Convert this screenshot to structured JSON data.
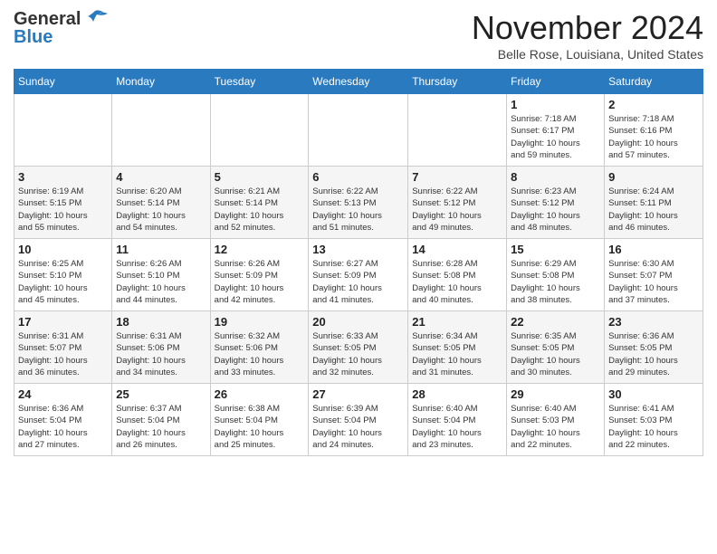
{
  "header": {
    "logo_line1": "General",
    "logo_line2": "Blue",
    "month_title": "November 2024",
    "location": "Belle Rose, Louisiana, United States"
  },
  "days_of_week": [
    "Sunday",
    "Monday",
    "Tuesday",
    "Wednesday",
    "Thursday",
    "Friday",
    "Saturday"
  ],
  "weeks": [
    [
      {
        "day": "",
        "info": ""
      },
      {
        "day": "",
        "info": ""
      },
      {
        "day": "",
        "info": ""
      },
      {
        "day": "",
        "info": ""
      },
      {
        "day": "",
        "info": ""
      },
      {
        "day": "1",
        "info": "Sunrise: 7:18 AM\nSunset: 6:17 PM\nDaylight: 10 hours\nand 59 minutes."
      },
      {
        "day": "2",
        "info": "Sunrise: 7:18 AM\nSunset: 6:16 PM\nDaylight: 10 hours\nand 57 minutes."
      }
    ],
    [
      {
        "day": "3",
        "info": "Sunrise: 6:19 AM\nSunset: 5:15 PM\nDaylight: 10 hours\nand 55 minutes."
      },
      {
        "day": "4",
        "info": "Sunrise: 6:20 AM\nSunset: 5:14 PM\nDaylight: 10 hours\nand 54 minutes."
      },
      {
        "day": "5",
        "info": "Sunrise: 6:21 AM\nSunset: 5:14 PM\nDaylight: 10 hours\nand 52 minutes."
      },
      {
        "day": "6",
        "info": "Sunrise: 6:22 AM\nSunset: 5:13 PM\nDaylight: 10 hours\nand 51 minutes."
      },
      {
        "day": "7",
        "info": "Sunrise: 6:22 AM\nSunset: 5:12 PM\nDaylight: 10 hours\nand 49 minutes."
      },
      {
        "day": "8",
        "info": "Sunrise: 6:23 AM\nSunset: 5:12 PM\nDaylight: 10 hours\nand 48 minutes."
      },
      {
        "day": "9",
        "info": "Sunrise: 6:24 AM\nSunset: 5:11 PM\nDaylight: 10 hours\nand 46 minutes."
      }
    ],
    [
      {
        "day": "10",
        "info": "Sunrise: 6:25 AM\nSunset: 5:10 PM\nDaylight: 10 hours\nand 45 minutes."
      },
      {
        "day": "11",
        "info": "Sunrise: 6:26 AM\nSunset: 5:10 PM\nDaylight: 10 hours\nand 44 minutes."
      },
      {
        "day": "12",
        "info": "Sunrise: 6:26 AM\nSunset: 5:09 PM\nDaylight: 10 hours\nand 42 minutes."
      },
      {
        "day": "13",
        "info": "Sunrise: 6:27 AM\nSunset: 5:09 PM\nDaylight: 10 hours\nand 41 minutes."
      },
      {
        "day": "14",
        "info": "Sunrise: 6:28 AM\nSunset: 5:08 PM\nDaylight: 10 hours\nand 40 minutes."
      },
      {
        "day": "15",
        "info": "Sunrise: 6:29 AM\nSunset: 5:08 PM\nDaylight: 10 hours\nand 38 minutes."
      },
      {
        "day": "16",
        "info": "Sunrise: 6:30 AM\nSunset: 5:07 PM\nDaylight: 10 hours\nand 37 minutes."
      }
    ],
    [
      {
        "day": "17",
        "info": "Sunrise: 6:31 AM\nSunset: 5:07 PM\nDaylight: 10 hours\nand 36 minutes."
      },
      {
        "day": "18",
        "info": "Sunrise: 6:31 AM\nSunset: 5:06 PM\nDaylight: 10 hours\nand 34 minutes."
      },
      {
        "day": "19",
        "info": "Sunrise: 6:32 AM\nSunset: 5:06 PM\nDaylight: 10 hours\nand 33 minutes."
      },
      {
        "day": "20",
        "info": "Sunrise: 6:33 AM\nSunset: 5:05 PM\nDaylight: 10 hours\nand 32 minutes."
      },
      {
        "day": "21",
        "info": "Sunrise: 6:34 AM\nSunset: 5:05 PM\nDaylight: 10 hours\nand 31 minutes."
      },
      {
        "day": "22",
        "info": "Sunrise: 6:35 AM\nSunset: 5:05 PM\nDaylight: 10 hours\nand 30 minutes."
      },
      {
        "day": "23",
        "info": "Sunrise: 6:36 AM\nSunset: 5:05 PM\nDaylight: 10 hours\nand 29 minutes."
      }
    ],
    [
      {
        "day": "24",
        "info": "Sunrise: 6:36 AM\nSunset: 5:04 PM\nDaylight: 10 hours\nand 27 minutes."
      },
      {
        "day": "25",
        "info": "Sunrise: 6:37 AM\nSunset: 5:04 PM\nDaylight: 10 hours\nand 26 minutes."
      },
      {
        "day": "26",
        "info": "Sunrise: 6:38 AM\nSunset: 5:04 PM\nDaylight: 10 hours\nand 25 minutes."
      },
      {
        "day": "27",
        "info": "Sunrise: 6:39 AM\nSunset: 5:04 PM\nDaylight: 10 hours\nand 24 minutes."
      },
      {
        "day": "28",
        "info": "Sunrise: 6:40 AM\nSunset: 5:04 PM\nDaylight: 10 hours\nand 23 minutes."
      },
      {
        "day": "29",
        "info": "Sunrise: 6:40 AM\nSunset: 5:03 PM\nDaylight: 10 hours\nand 22 minutes."
      },
      {
        "day": "30",
        "info": "Sunrise: 6:41 AM\nSunset: 5:03 PM\nDaylight: 10 hours\nand 22 minutes."
      }
    ]
  ]
}
